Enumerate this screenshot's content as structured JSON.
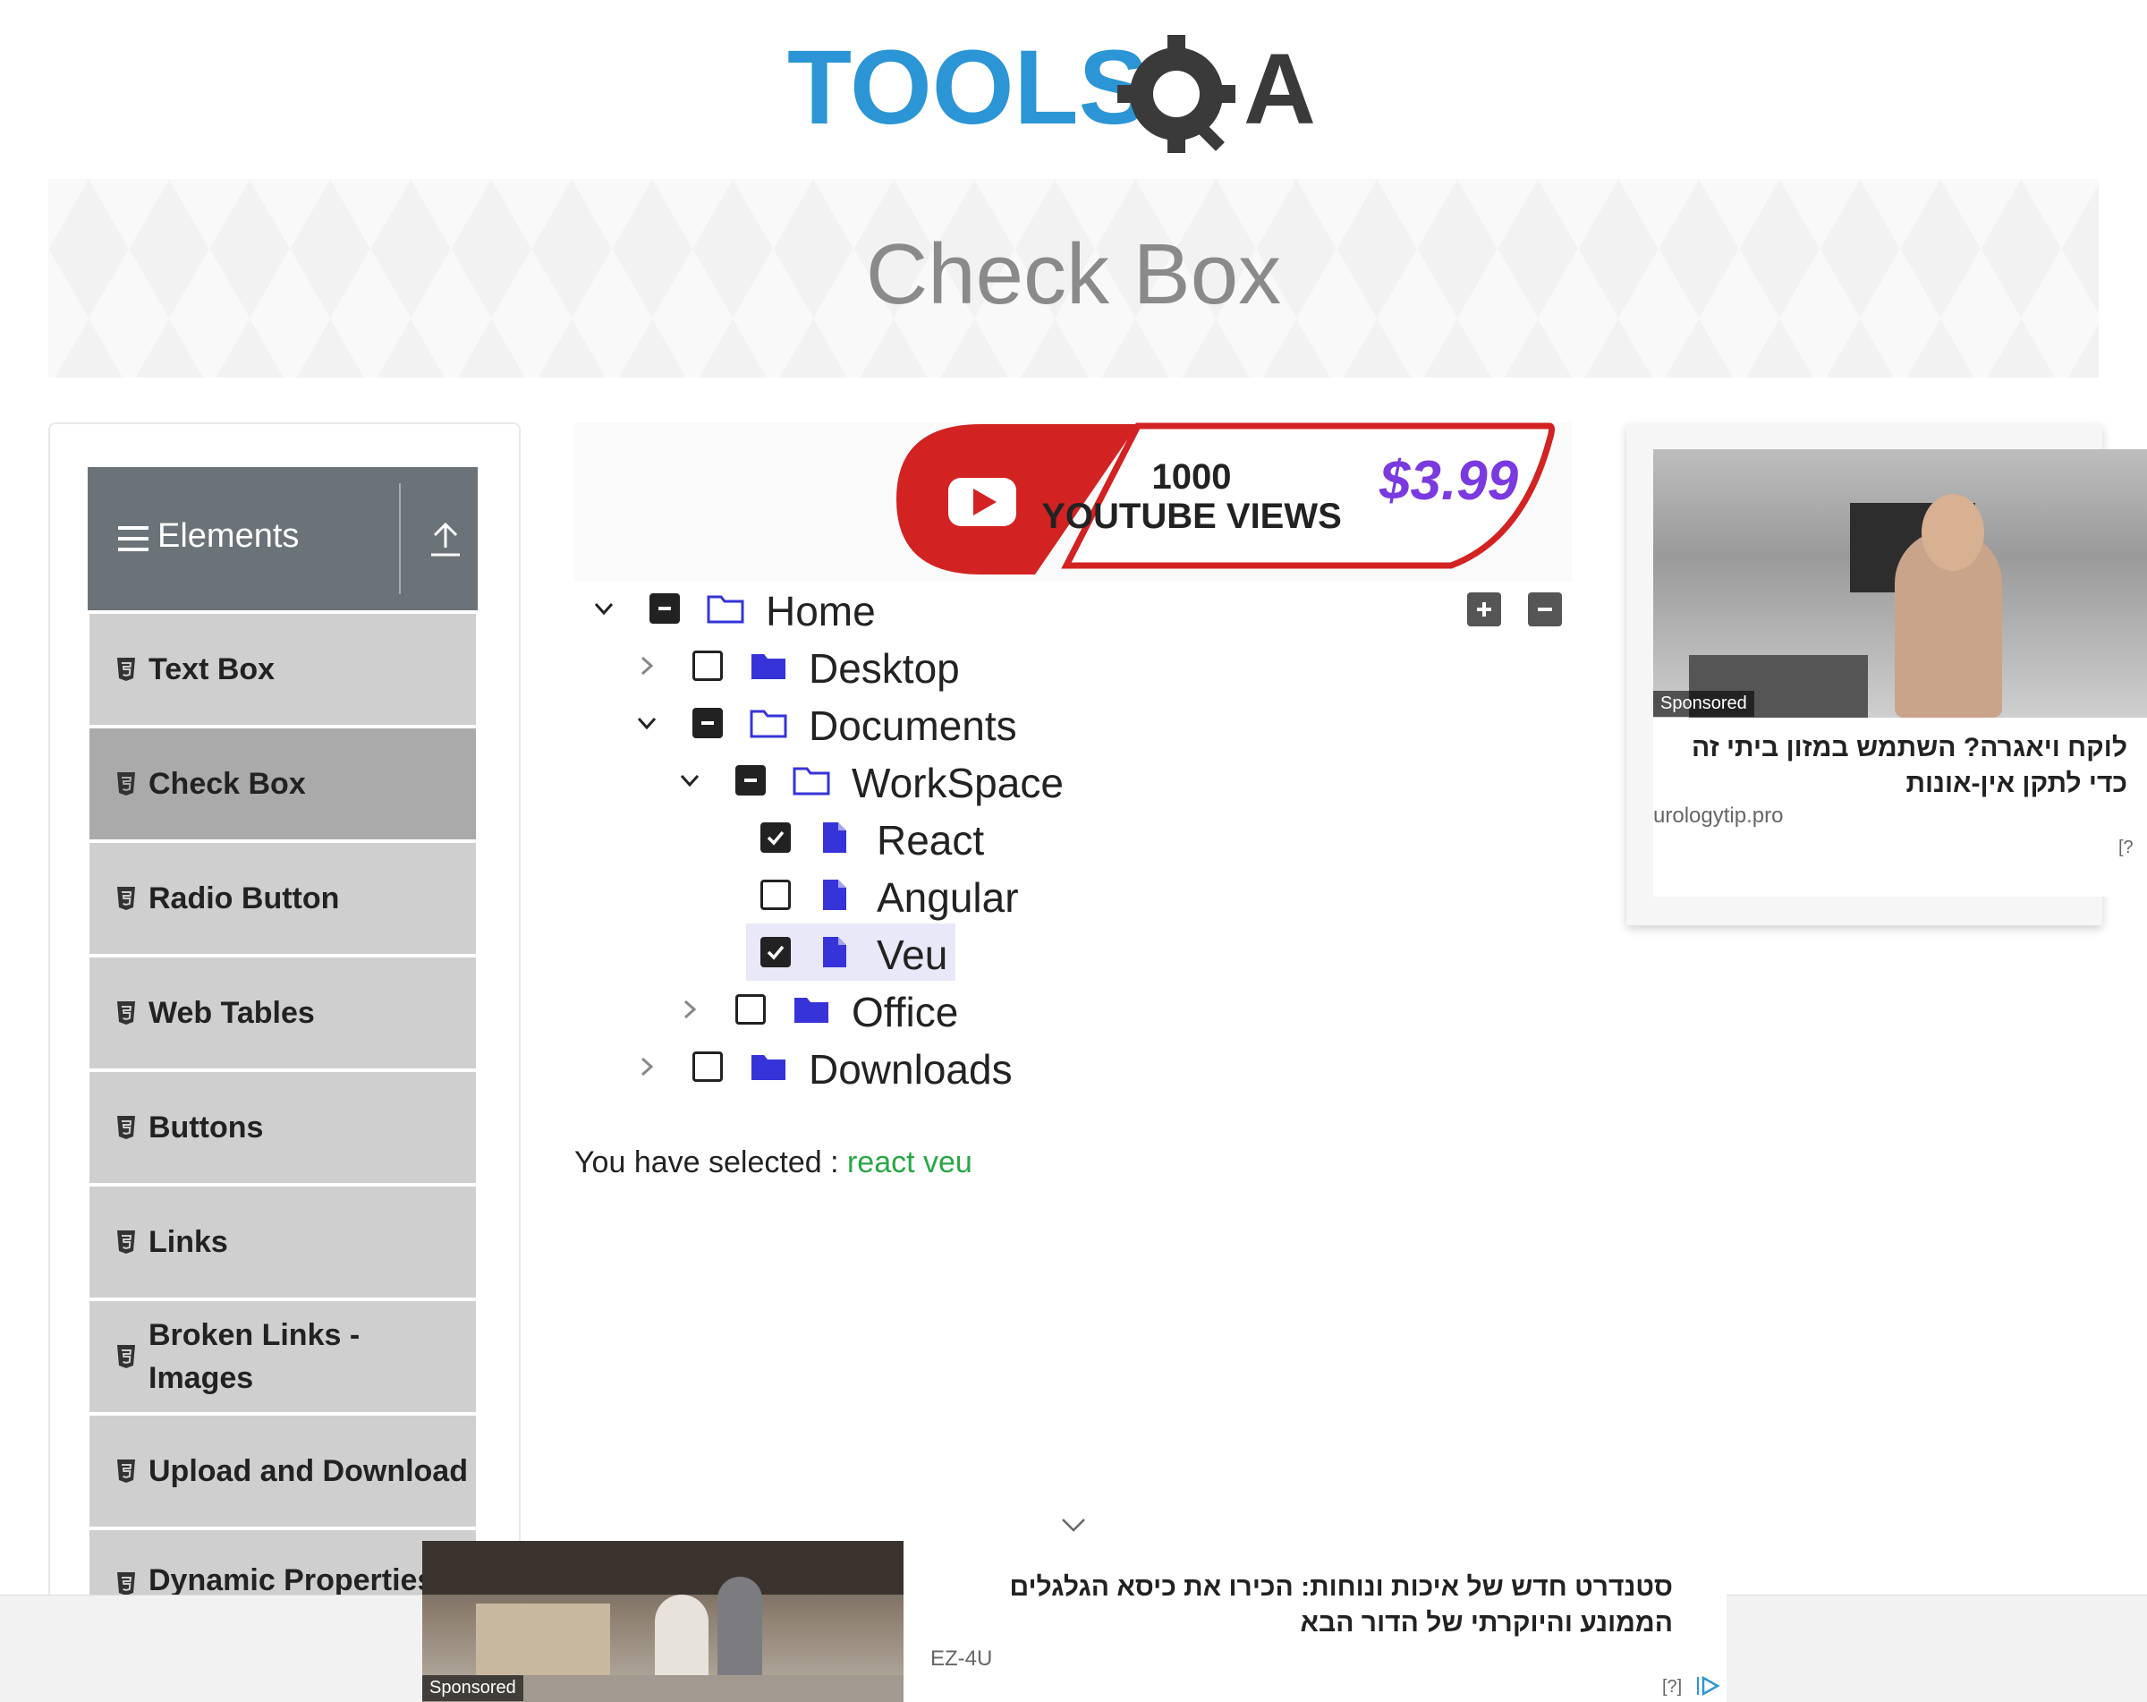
{
  "logo": {
    "text_part": "TOOLS",
    "qa_part": "QA"
  },
  "banner": {
    "title": "Check Box"
  },
  "nav": {
    "group_title": "Elements",
    "items": [
      {
        "label": "Text Box"
      },
      {
        "label": "Check Box",
        "active": true
      },
      {
        "label": "Radio Button"
      },
      {
        "label": "Web Tables"
      },
      {
        "label": "Buttons"
      },
      {
        "label": "Links"
      },
      {
        "label": "Broken Links - Images"
      },
      {
        "label": "Upload and Download"
      },
      {
        "label": "Dynamic Properties"
      }
    ]
  },
  "center_ad": {
    "line1": "1000",
    "line2": "YOUTUBE VIEWS",
    "price": "$3.99"
  },
  "tree": {
    "nodes": [
      {
        "label": "Home",
        "state": "half",
        "expanded": true
      },
      {
        "label": "Desktop",
        "state": "unchecked",
        "expanded": false
      },
      {
        "label": "Documents",
        "state": "half",
        "expanded": true
      },
      {
        "label": "WorkSpace",
        "state": "half",
        "expanded": true
      },
      {
        "label": "React",
        "state": "checked"
      },
      {
        "label": "Angular",
        "state": "unchecked"
      },
      {
        "label": "Veu",
        "state": "checked"
      },
      {
        "label": "Office",
        "state": "unchecked",
        "expanded": false
      },
      {
        "label": "Downloads",
        "state": "unchecked",
        "expanded": false
      }
    ]
  },
  "result": {
    "prefix": "You have selected :",
    "selected": "react veu"
  },
  "side_ad": {
    "sponsored": "Sponsored",
    "headline": "לוקח ויאגרה? השתמש במזון ביתי זה כדי לתקן אין-אונות",
    "source": "urologytip.pro",
    "info": "[?"
  },
  "bottom_ad": {
    "sponsored": "Sponsored",
    "headline": "סטנדרט חדש של איכות ונוחות: הכירו את כיסא הגלגלים הממונע והיוקרתי של הדור הבא",
    "source": "EZ-4U",
    "info": "[?]"
  },
  "colors": {
    "nav_header": "#6b7278",
    "nav_item": "#cfcfcf",
    "nav_active": "#aaaaaa",
    "icon_blue": "#3634d8",
    "selected_green": "#28a745"
  }
}
